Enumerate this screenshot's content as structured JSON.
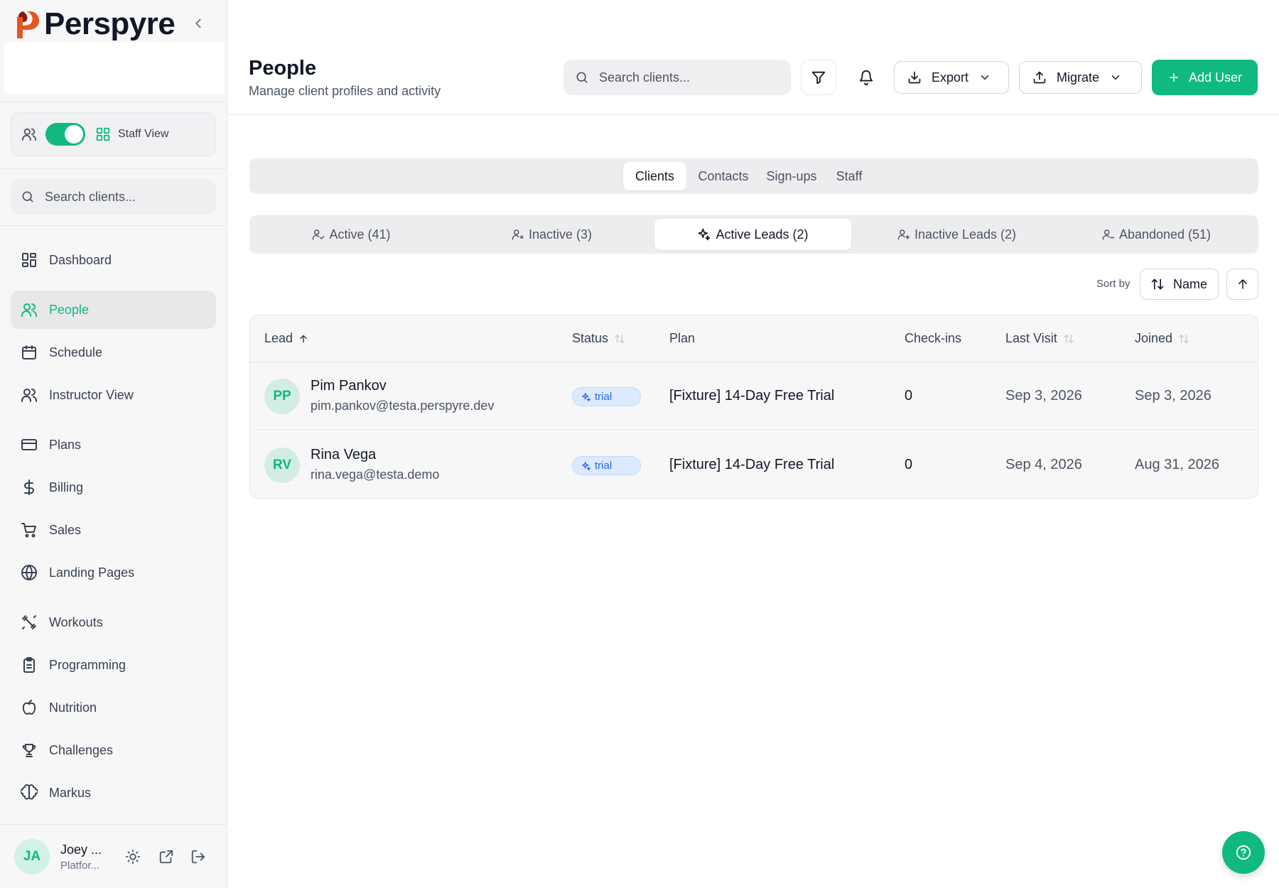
{
  "brand": {
    "name": "Perspyre"
  },
  "sidebar": {
    "view_toggle_label": "Staff View",
    "search_placeholder": "Search clients...",
    "items": [
      {
        "label": "Dashboard",
        "icon": "dashboard-icon"
      },
      {
        "label": "People",
        "icon": "users-icon",
        "active": true
      },
      {
        "label": "Schedule",
        "icon": "calendar-icon"
      },
      {
        "label": "Instructor View",
        "icon": "users-icon"
      },
      {
        "label": "Plans",
        "icon": "credit-card-icon"
      },
      {
        "label": "Billing",
        "icon": "dollar-icon"
      },
      {
        "label": "Sales",
        "icon": "cart-icon"
      },
      {
        "label": "Landing Pages",
        "icon": "globe-icon"
      },
      {
        "label": "Workouts",
        "icon": "dumbbell-icon"
      },
      {
        "label": "Programming",
        "icon": "clipboard-icon"
      },
      {
        "label": "Nutrition",
        "icon": "apple-icon"
      },
      {
        "label": "Challenges",
        "icon": "trophy-icon"
      },
      {
        "label": "Markus",
        "icon": "brain-icon"
      }
    ],
    "user": {
      "initials": "JA",
      "name": "Joey ...",
      "role": "Platfor..."
    }
  },
  "header": {
    "title": "People",
    "subtitle": "Manage client profiles and activity",
    "search_placeholder": "Search clients...",
    "export_label": "Export",
    "migrate_label": "Migrate",
    "add_user_label": "Add User"
  },
  "tabs": [
    "Clients",
    "Contacts",
    "Sign-ups",
    "Staff"
  ],
  "active_tab": "Clients",
  "sub_tabs": [
    "Active (41)",
    "Inactive (3)",
    "Active Leads (2)",
    "Inactive Leads (2)",
    "Abandoned (51)"
  ],
  "active_sub_tab": "Active Leads (2)",
  "sort": {
    "label": "Sort by",
    "field": "Name"
  },
  "table": {
    "columns": [
      "Lead",
      "Status",
      "Plan",
      "Check-ins",
      "Last Visit",
      "Joined"
    ],
    "rows": [
      {
        "initials": "PP",
        "name": "Pim Pankov",
        "email": "pim.pankov@testa.perspyre.dev",
        "status": "trial",
        "plan": "[Fixture] 14-Day Free Trial",
        "checkins": "0",
        "last_visit": "Sep 3, 2026",
        "joined": "Sep 3, 2026"
      },
      {
        "initials": "RV",
        "name": "Rina Vega",
        "email": "rina.vega@testa.demo",
        "status": "trial",
        "plan": "[Fixture] 14-Day Free Trial",
        "checkins": "0",
        "last_visit": "Sep 4, 2026",
        "joined": "Aug 31, 2026"
      }
    ]
  },
  "colors": {
    "accent": "#10b981",
    "badge": "#2563eb",
    "badge_bg": "#dbeafe"
  }
}
